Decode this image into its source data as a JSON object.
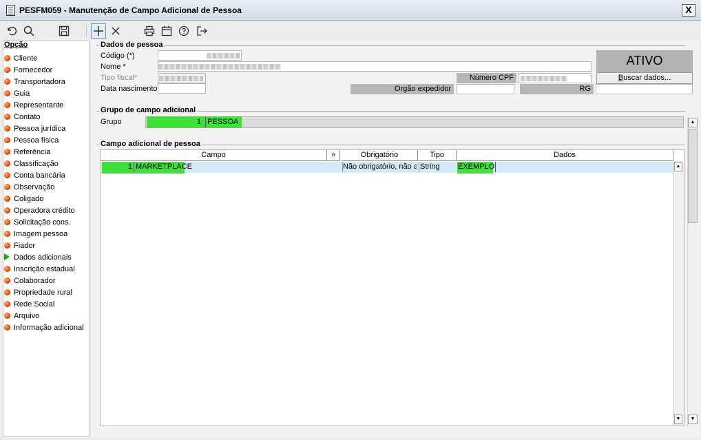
{
  "window": {
    "title": "PESFM059 - Manutenção de Campo Adicional de Pessoa",
    "close_label": "X"
  },
  "toolbar": [
    "undo-icon",
    "search-icon",
    "save-icon",
    "add-icon",
    "close-icon",
    "print-icon",
    "calendar-icon",
    "help-icon",
    "exit-icon"
  ],
  "sidebar": {
    "heading": "Opção",
    "items": [
      {
        "label": "Cliente",
        "icon": "dot"
      },
      {
        "label": "Fornecedor",
        "icon": "dot"
      },
      {
        "label": "Transportadora",
        "icon": "dot"
      },
      {
        "label": "Guia",
        "icon": "dot"
      },
      {
        "label": "Representante",
        "icon": "dot"
      },
      {
        "label": "Contato",
        "icon": "dot"
      },
      {
        "label": "Pessoa jurídica",
        "icon": "dot"
      },
      {
        "label": "Pessoa física",
        "icon": "dot"
      },
      {
        "label": "Referência",
        "icon": "dot"
      },
      {
        "label": "Classificação",
        "icon": "dot"
      },
      {
        "label": "Conta bancária",
        "icon": "dot"
      },
      {
        "label": "Observação",
        "icon": "dot"
      },
      {
        "label": "Coligado",
        "icon": "dot"
      },
      {
        "label": "Operadora crédito",
        "icon": "dot"
      },
      {
        "label": "Solicitação cons.",
        "icon": "dot"
      },
      {
        "label": "Imagem pessoa",
        "icon": "dot"
      },
      {
        "label": "Fiador",
        "icon": "dot"
      },
      {
        "label": "Dados adicionais",
        "icon": "arrow"
      },
      {
        "label": "Inscrição estadual",
        "icon": "dot"
      },
      {
        "label": "Colaborador",
        "icon": "dot"
      },
      {
        "label": "Propriedade rural",
        "icon": "dot"
      },
      {
        "label": "Rede Social",
        "icon": "dot"
      },
      {
        "label": "Arquivo",
        "icon": "dot"
      },
      {
        "label": "Informação adicional",
        "icon": "dot"
      }
    ]
  },
  "dados_pessoa": {
    "title": "Dados de pessoa",
    "codigo_label": "Código (*)",
    "nome_label": "Nome *",
    "tipo_fiscal_label": "Tipo fiscal*",
    "data_nascimento_label": "Data nascimento",
    "numero_cpf_label": "Número CPF",
    "orgao_expedidor_label": "Orgão expedidor",
    "rg_label": "RG",
    "status": "ATIVO",
    "buscar_label": "Buscar dados..."
  },
  "grupo": {
    "title": "Grupo de campo adicional",
    "label": "Grupo",
    "code": "1",
    "name": "PESSOA"
  },
  "campo": {
    "title": "Campo adicional de pessoa",
    "columns": [
      "Campo",
      "»",
      "Obrigatório",
      "Tipo",
      "Dados"
    ],
    "rows": [
      {
        "code": "1",
        "campo": "MARKETPLACE",
        "obrigatorio": "Não obrigatório, não a",
        "tipo": "String",
        "dados": "EXEMPLO"
      }
    ]
  },
  "colors": {
    "highlight": "#3ee13a",
    "row_selected": "#d5eaf7",
    "status_bg": "#b3b3b3"
  }
}
